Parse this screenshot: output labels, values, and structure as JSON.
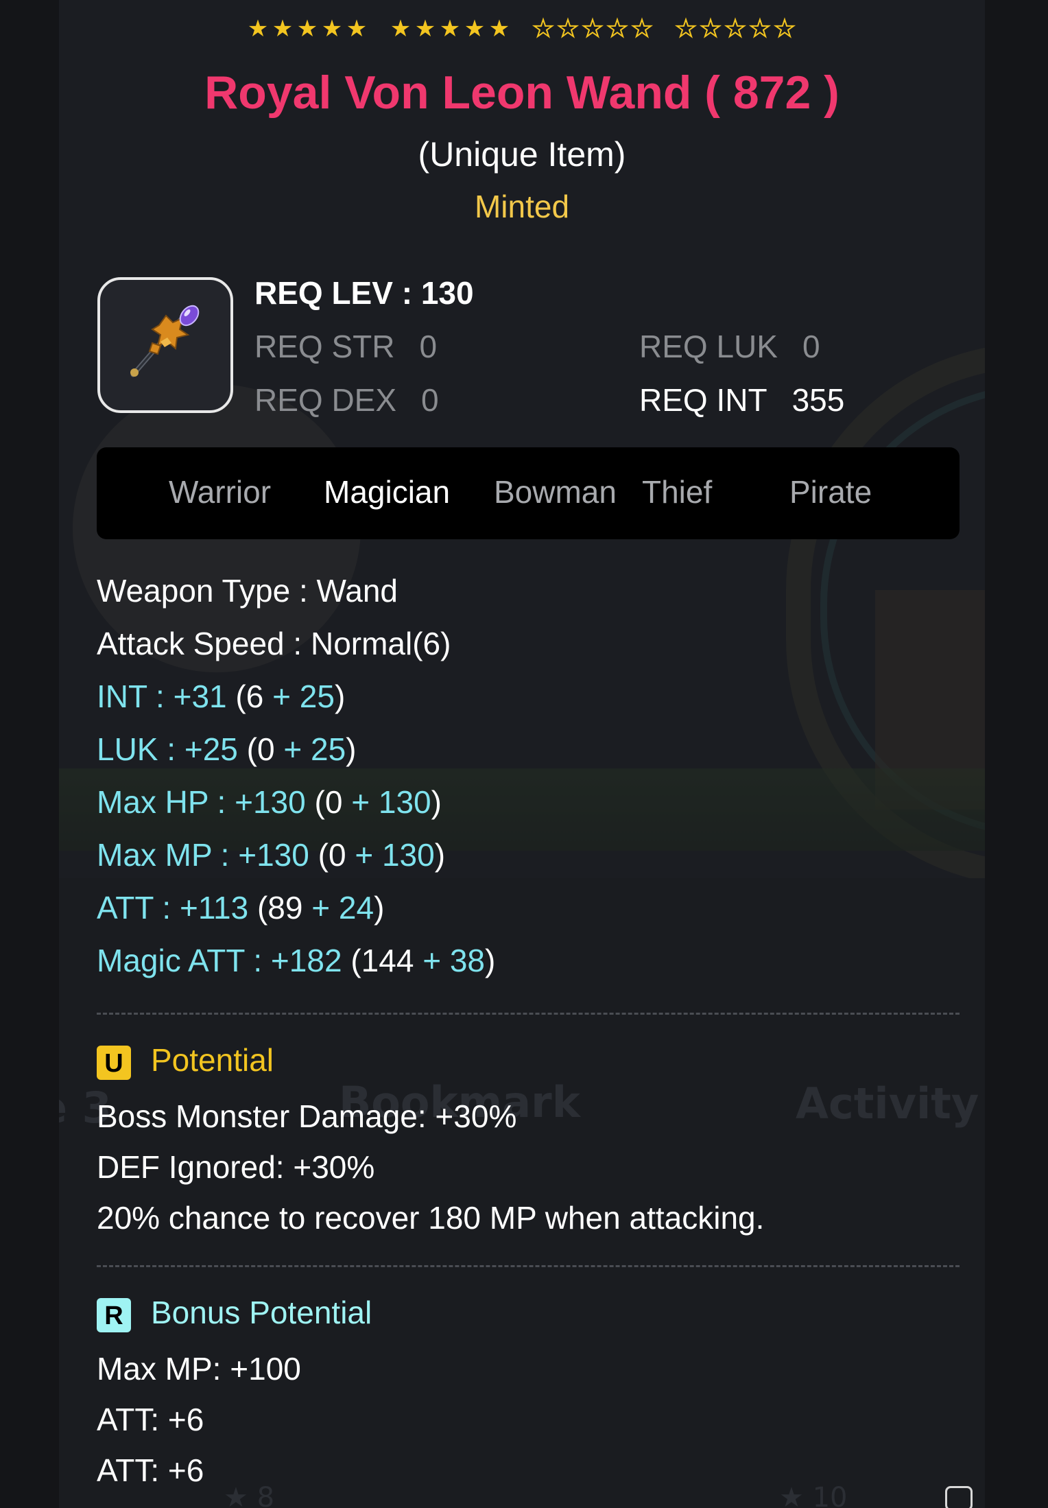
{
  "item": {
    "title": "Royal Von Leon Wand ( 872 )",
    "rarity": "(Unique Item)",
    "status": "Minted",
    "star_groups": [
      {
        "filled": 5,
        "total": 5
      },
      {
        "filled": 5,
        "total": 5
      },
      {
        "filled": 0,
        "total": 5
      },
      {
        "filled": 0,
        "total": 5
      }
    ],
    "star_filled_total": 10,
    "star_max": 20,
    "icon": "wand-icon"
  },
  "requirements": {
    "level_label": "REQ LEV",
    "level_sep": ":",
    "level_value": "130",
    "str_label": "REQ STR",
    "str_value": "0",
    "dex_label": "REQ DEX",
    "dex_value": "0",
    "luk_label": "REQ LUK",
    "luk_value": "0",
    "int_label": "REQ INT",
    "int_value": "355"
  },
  "jobs": {
    "items": [
      "Warrior",
      "Magician",
      "Bowman",
      "Thief",
      "Pirate"
    ],
    "active": "Magician"
  },
  "stats": {
    "weapon_type": {
      "label": "Weapon Type :",
      "value": "Wand"
    },
    "attack_speed": {
      "label": "Attack Speed :",
      "value": "Normal(6)"
    },
    "int": {
      "label": "INT :",
      "total": "+31",
      "base": "6",
      "bonus": "25"
    },
    "luk": {
      "label": "LUK :",
      "total": "+25",
      "base": "0",
      "bonus": "25"
    },
    "max_hp": {
      "label": "Max HP :",
      "total": "+130",
      "base": "0",
      "bonus": "130"
    },
    "max_mp": {
      "label": "Max MP :",
      "total": "+130",
      "base": "0",
      "bonus": "130"
    },
    "att": {
      "label": "ATT :",
      "total": "+113",
      "base": "89",
      "bonus": "24"
    },
    "magic_att": {
      "label": "Magic ATT :",
      "total": "+182",
      "base": "144",
      "bonus": "38"
    }
  },
  "potential": {
    "badge": "U",
    "title": "Potential",
    "lines": [
      "Boss Monster Damage: +30%",
      "DEF Ignored: +30%",
      "20% chance to recover 180 MP when attacking."
    ]
  },
  "bonus_potential": {
    "badge": "R",
    "title": "Bonus Potential",
    "lines": [
      "Max MP: +100",
      "ATT: +6",
      "ATT: +6"
    ]
  },
  "background_text": {
    "left_fragment": "e 3",
    "bookmark": "Bookmark",
    "activity": "Activity",
    "count_left": "8",
    "count_right": "10"
  },
  "colors": {
    "title": "#f0386e",
    "minted": "#f3c84a",
    "star": "#f3c520",
    "stat_cyan": "#7fe3ee",
    "potential_gold": "#f3c520",
    "bonus_cyan": "#9ff3f3"
  }
}
